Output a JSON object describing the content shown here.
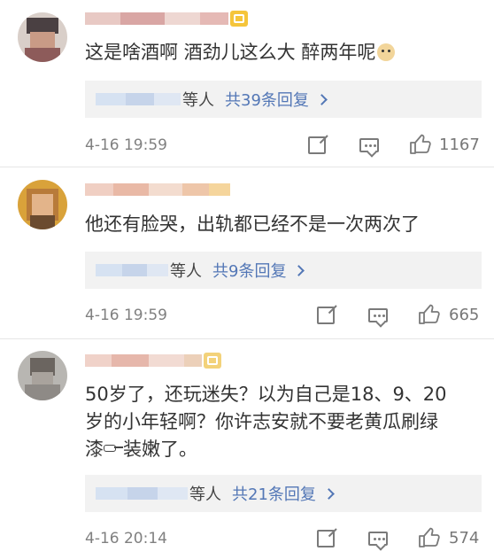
{
  "comments": [
    {
      "text": "这是啥酒啊 酒劲儿这么大 醉两年呢",
      "reply_who": "等人",
      "reply_link": "共39条回复",
      "time": "4-16 19:59",
      "likes": "1167"
    },
    {
      "text": "他还有脸哭，出轨都已经不是一次两次了",
      "reply_who": "等人",
      "reply_link": "共9条回复",
      "time": "4-16 19:59",
      "likes": "665"
    },
    {
      "text_line1": "50岁了，还玩迷失？以为自己是18、9、20",
      "text_line2a": "岁的小年轻啊？你许志安就不要老黄瓜刷绿",
      "text_line3a": "漆",
      "text_line3b": "装嫩了。",
      "reply_who": "等人",
      "reply_link": "共21条回复",
      "time": "4-16 20:14",
      "likes": "574"
    }
  ],
  "colors": {
    "link": "#5377b6",
    "meta": "#808080",
    "reply_bg": "#f2f2f2",
    "vip": "#f5c53b"
  }
}
